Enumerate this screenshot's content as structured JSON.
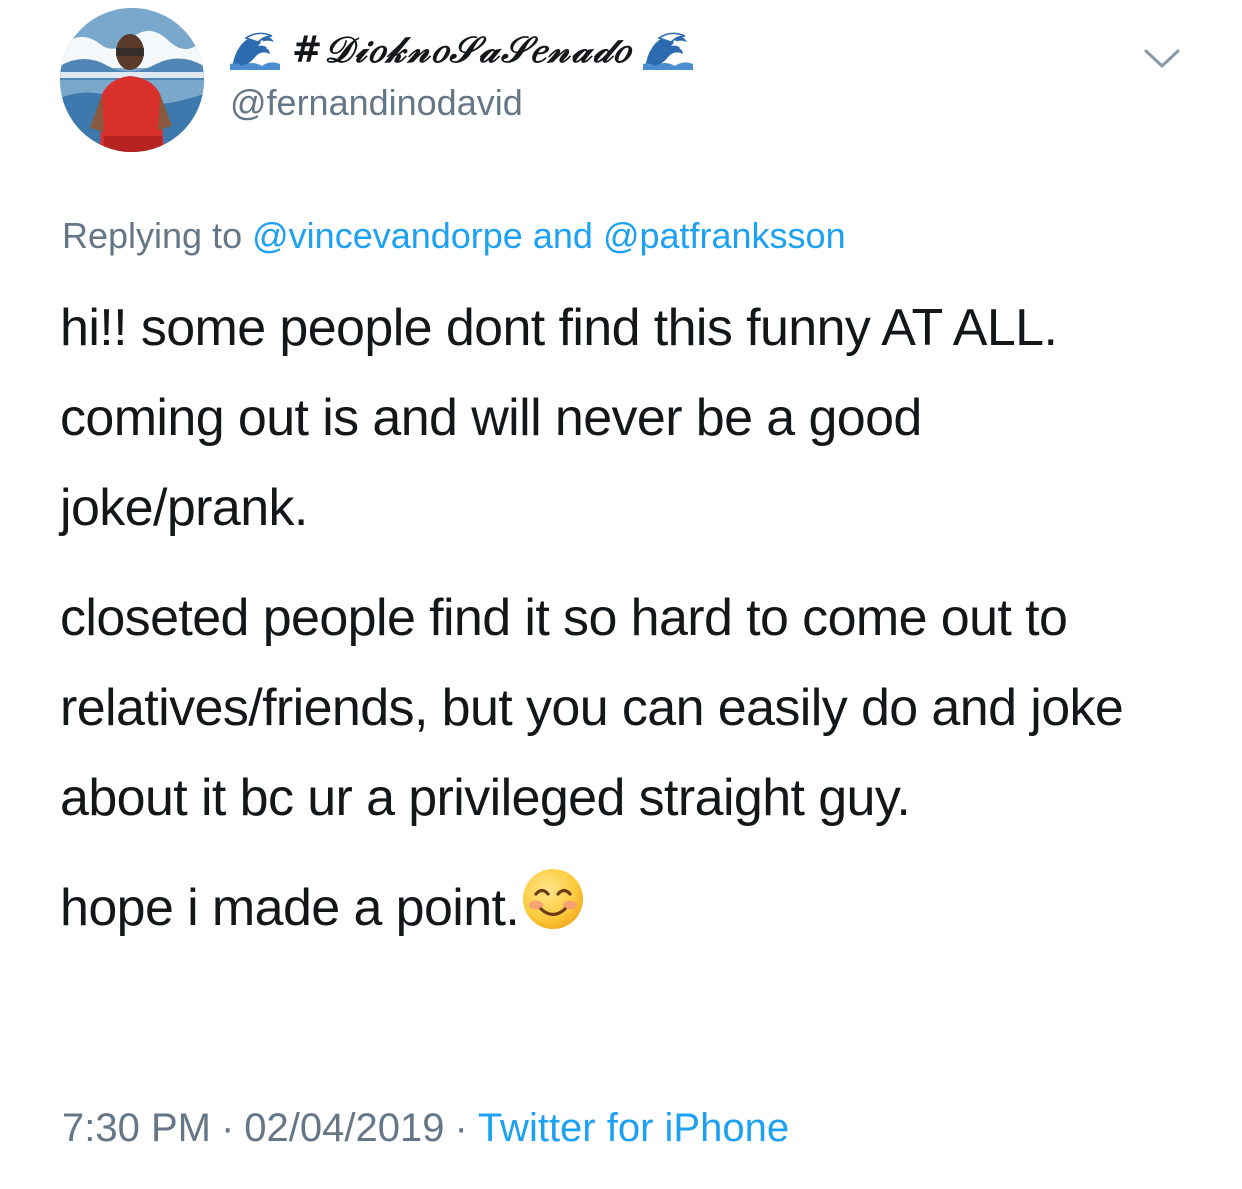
{
  "author": {
    "display_name": "#𝒟𝒾𝑜𝓀𝓃𝑜𝒮𝒶𝒮𝑒𝓃𝒶𝒹𝑜",
    "handle": "@fernandinodavid",
    "name_decoration_icon": "water-wave-emoji"
  },
  "reply": {
    "prefix": "Replying to",
    "mention_1": "@vincevandorpe",
    "conjunction": "and",
    "mention_2": "@patfranksson"
  },
  "body": {
    "paragraph_1": "hi!! some people dont find this funny AT ALL. coming out is and will never be a good joke/prank.",
    "paragraph_2": "closeted people find it so hard to come out to relatives/friends, but you can easily do and joke about it bc ur a privileged straight guy.",
    "paragraph_3": "hope i made a point.",
    "emoji_icon": "smiling-face-with-smiling-eyes"
  },
  "meta": {
    "time": "7:30 PM",
    "separator": "·",
    "date": "02/04/2019",
    "source": "Twitter for iPhone"
  },
  "colors": {
    "text": "#14171a",
    "secondary": "#657786",
    "link": "#1da1f2"
  }
}
